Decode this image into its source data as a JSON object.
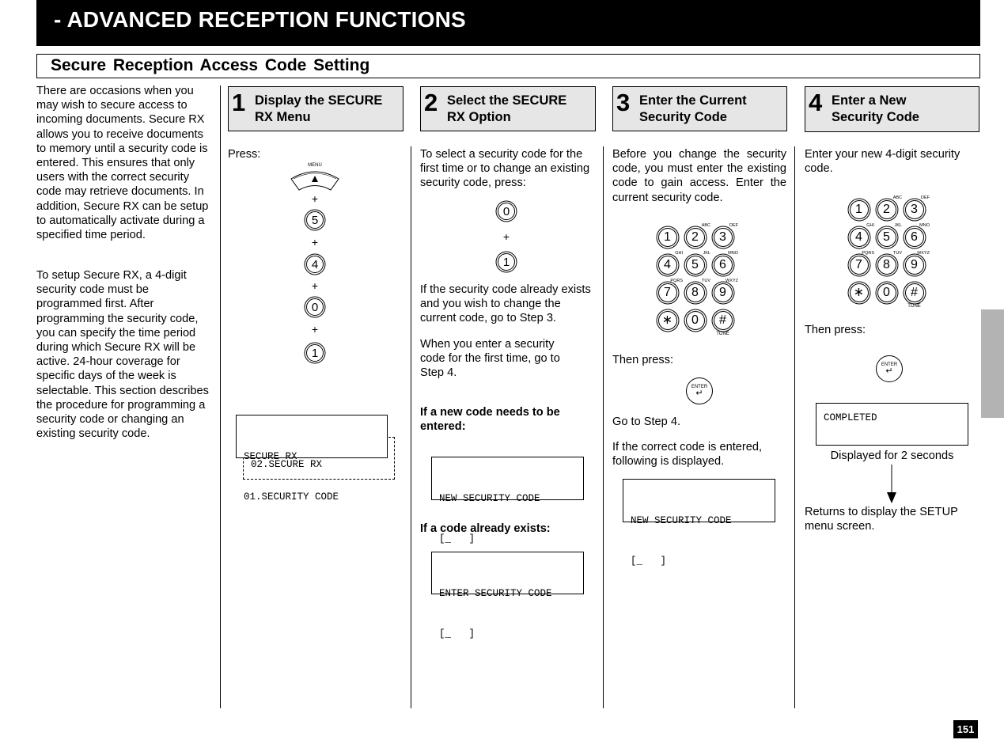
{
  "header": {
    "title": "- ADVANCED RECEPTION FUNCTIONS",
    "section_title": "Secure Reception Access Code Setting"
  },
  "intro": {
    "paragraphs": [
      "There are occasions when you may wish to secure access to incoming documents. Secure RX allows you to receive documents to memory until a security code is entered. This ensures that only users with the correct security code may retrieve documents. In addition, Secure RX can be setup to automatically activate during a specified time period.",
      "To setup Secure RX, a 4-digit security code must be programmed first. After programming the security code, you can specify the time period during which Secure RX will be active. 24-hour coverage for specific days of the week is selectable. This section describes the procedure for programming a security code or changing an existing security code."
    ]
  },
  "steps": [
    {
      "number": "1",
      "title_line1": "Display the SECURE",
      "title_line2": "RX Menu",
      "press_label": "Press:",
      "menu_key_label": "MENU",
      "menu_key_icon": "up-triangle",
      "plus": "+",
      "keys": [
        "5",
        "4",
        "0",
        "1"
      ],
      "lcd_line1": "SECURE RX",
      "lcd_line2": "01.SECURITY CODE",
      "lcd_next": "02.SECURE RX"
    },
    {
      "number": "2",
      "title_line1": "Select the SECURE",
      "title_line2": "RX Option",
      "text1": "To select a security code for the first time or to change an existing security code,   press:",
      "keys": [
        "0",
        "1"
      ],
      "plus": "+",
      "text2": "If the security code already exists and you wish to change the current code, go to Step 3.",
      "text3": "When you enter a security code for the first time, go to Step 4.",
      "new_code_heading": "If a new code needs to be entered:",
      "lcd_new_line1": "NEW SECURITY CODE",
      "lcd_new_line2": "[_   ]",
      "exists_heading": "If a code already exists:",
      "lcd_enter_line1": "ENTER SECURITY CODE",
      "lcd_enter_line2": "[_   ]"
    },
    {
      "number": "3",
      "title_line1": "Enter the Current",
      "title_line2": "Security Code",
      "text1": "Before you change the security code, you must enter the existing code to gain access. Enter the current security code.",
      "then_press": "Then press:",
      "enter_key_label": "ENTER",
      "go_to": "Go to Step 4.",
      "text2": "If the correct code is entered, following is displayed.",
      "lcd_line1": "NEW SECURITY CODE",
      "lcd_line2": "[_   ]"
    },
    {
      "number": "4",
      "title_line1": "Enter a New",
      "title_line2": "Security Code",
      "text1": "Enter your new 4-digit security code.",
      "then_press": "Then press:",
      "enter_key_label": "ENTER",
      "lcd_line1": "COMPLETED",
      "displayed_for": "Displayed for 2 seconds",
      "returns": "Returns to display the SETUP menu screen."
    }
  ],
  "keypad": {
    "keys": [
      {
        "key": "1",
        "sub": ""
      },
      {
        "key": "2",
        "sub": "ABC"
      },
      {
        "key": "3",
        "sub": "DEF"
      },
      {
        "key": "4",
        "sub": "GHI"
      },
      {
        "key": "5",
        "sub": "JKL"
      },
      {
        "key": "6",
        "sub": "MNO"
      },
      {
        "key": "7",
        "sub": "PQRS"
      },
      {
        "key": "8",
        "sub": "TUV"
      },
      {
        "key": "9",
        "sub": "WXYZ"
      },
      {
        "key": "∗",
        "sub": ""
      },
      {
        "key": "0",
        "sub": ""
      },
      {
        "key": "#",
        "sub": ""
      }
    ],
    "tone_label": "TONE"
  },
  "footer": {
    "page_number": "151"
  },
  "colors": {
    "header_bg": "#000000",
    "step_box_bg": "#e6e6e6",
    "side_tab": "#b3b3b3"
  }
}
